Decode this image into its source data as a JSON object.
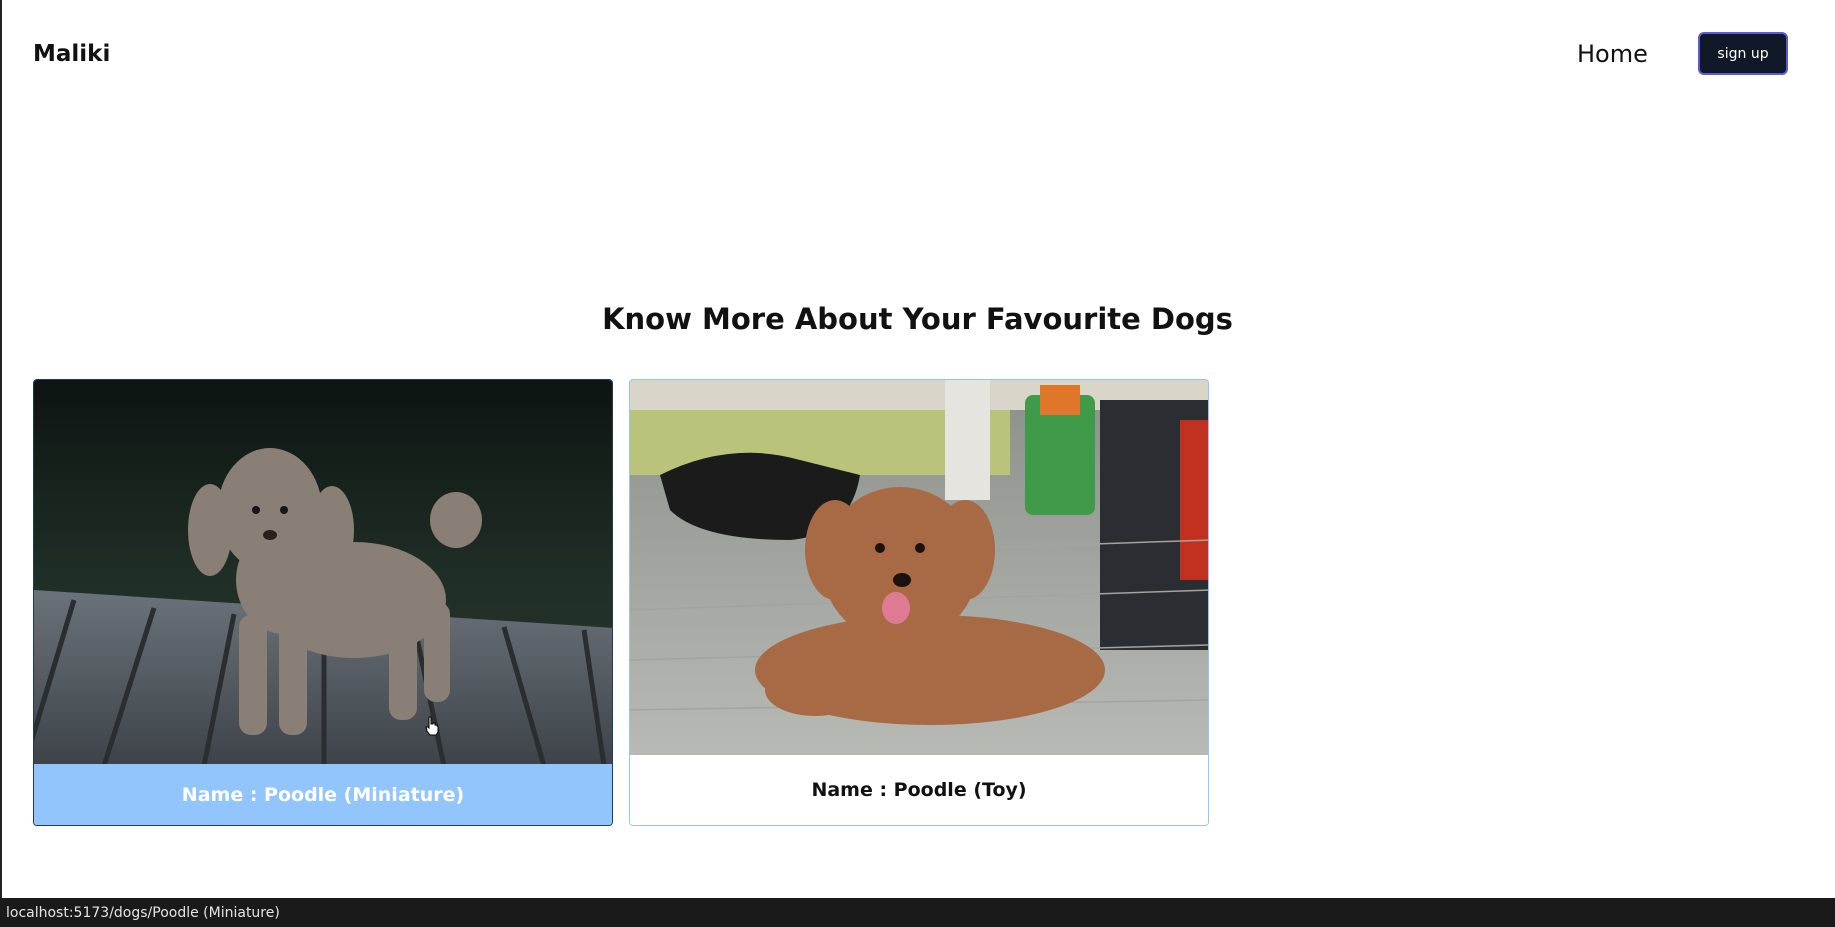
{
  "nav": {
    "brand": "Maliki",
    "home_label": "Home",
    "signup_label": "sign up"
  },
  "main": {
    "title": "Know More About Your Favourite Dogs",
    "cards": [
      {
        "caption": "Name : Poodle (Miniature)",
        "image_alt": "grey poodle standing on wooden dock"
      },
      {
        "caption": "Name : Poodle (Toy)",
        "image_alt": "brown toy poodle lying on paving stones"
      }
    ]
  },
  "status": {
    "url": "localhost:5173/dogs/Poodle (Miniature)"
  },
  "colors": {
    "accent_light_blue": "#93c5fd",
    "button_dark": "#111827"
  }
}
